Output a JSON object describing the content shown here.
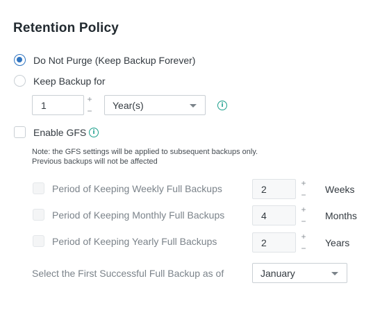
{
  "section": {
    "title": "Retention Policy"
  },
  "purge": {
    "option_no_purge": "Do Not Purge (Keep Backup Forever)",
    "option_keep_for": "Keep Backup for",
    "selected": "no_purge",
    "keep_value": "1",
    "keep_unit": "Year(s)"
  },
  "gfs": {
    "enable_label": "Enable GFS",
    "enabled": false,
    "note_line1": "Note: the GFS settings will be applied to subsequent backups only.",
    "note_line2": "Previous backups will not be affected",
    "weekly": {
      "label": "Period of Keeping Weekly Full Backups",
      "value": "2",
      "unit": "Weeks"
    },
    "monthly": {
      "label": "Period of Keeping Monthly Full Backups",
      "value": "4",
      "unit": "Months"
    },
    "yearly": {
      "label": "Period of Keeping Yearly Full Backups",
      "value": "2",
      "unit": "Years"
    },
    "first_backup_label": "Select the First Successful Full Backup as of",
    "first_backup_month": "January"
  },
  "stepper": {
    "plus": "+",
    "minus": "−"
  },
  "icons": {
    "info": "i"
  },
  "colors": {
    "accent": "#2f74c0",
    "info": "#1a9f8b"
  }
}
